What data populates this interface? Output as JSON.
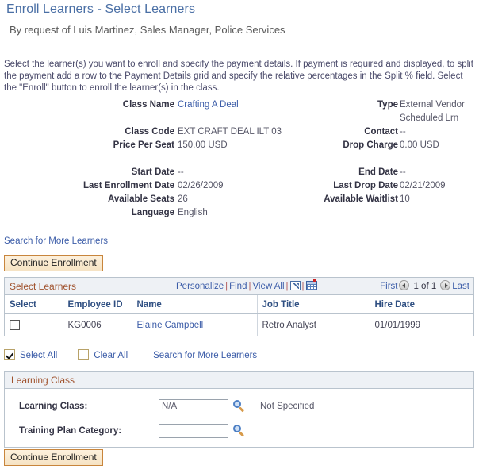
{
  "header": {
    "title": "Enroll Learners - Select Learners",
    "subtitle": "By request of Luis Martinez, Sales Manager, Police Services"
  },
  "instructions": "Select the learner(s) you want to enroll and specify the payment details. If payment is required and displayed, to split the payment add a row to the Payment Details grid and specify the relative percentages in the Split % field. Select the \"Enroll\" button to enroll the learner(s) in the class.",
  "class_details": {
    "left": [
      {
        "label": "Class Name",
        "value": "Crafting A Deal",
        "is_link": true
      },
      {
        "label": "Class Code",
        "value": "EXT CRAFT DEAL ILT 03",
        "is_link": false
      },
      {
        "label": "Price Per Seat",
        "value": "150.00 USD",
        "is_link": false
      },
      {
        "label": "Start Date",
        "value": "--",
        "is_link": false
      },
      {
        "label": "Last Enrollment Date",
        "value": "02/26/2009",
        "is_link": false
      },
      {
        "label": "Available Seats",
        "value": "26",
        "is_link": false
      },
      {
        "label": "Language",
        "value": "English",
        "is_link": false
      }
    ],
    "right": [
      {
        "label": "Type",
        "value": "External Vendor",
        "is_link": false
      },
      {
        "label": "",
        "value": "Scheduled Lrn",
        "is_link": false
      },
      {
        "label": "Contact",
        "value": "--",
        "is_link": false
      },
      {
        "label": "Drop Charge",
        "value": "0.00 USD",
        "is_link": false
      },
      {
        "label": "End Date",
        "value": "--",
        "is_link": false
      },
      {
        "label": "Last Drop Date",
        "value": "02/21/2009",
        "is_link": false
      },
      {
        "label": "Available Waitlist",
        "value": "10",
        "is_link": false
      }
    ]
  },
  "links": {
    "search_more_top": "Search for More Learners",
    "search_more_bottom": "Search for More Learners"
  },
  "buttons": {
    "continue_top": "Continue Enrollment",
    "continue_bottom": "Continue Enrollment"
  },
  "grid": {
    "title": "Select Learners",
    "tools": {
      "personalize": "Personalize",
      "find": "Find",
      "view_all": "View All",
      "expand_icon": "expand-grid-icon",
      "download_icon": "download-to-spreadsheet-icon"
    },
    "nav": {
      "first": "First",
      "counter": "1 of 1",
      "last": "Last",
      "prev_icon": "previous-page-icon",
      "next_icon": "next-page-icon"
    },
    "columns": [
      "Select",
      "Employee ID",
      "Name",
      "Job Title",
      "Hire Date"
    ],
    "rows": [
      {
        "selected": false,
        "employee_id": "KG0006",
        "name": "Elaine Campbell",
        "job_title": "Retro Analyst",
        "hire_date": "01/01/1999"
      }
    ]
  },
  "select_actions": {
    "select_all": "Select All",
    "clear_all": "Clear All"
  },
  "learning_class": {
    "panel_title": "Learning Class",
    "fields": [
      {
        "label": "Learning Class:",
        "value": "N/A",
        "note": "Not Specified"
      },
      {
        "label": "Training Plan Category:",
        "value": "",
        "note": ""
      }
    ]
  },
  "colors": {
    "title_blue": "#4a6fa5",
    "link_blue": "#3b5ca8",
    "section_brown": "#a0522d",
    "column_header_blue": "#2f4f82",
    "button_fill": "#fae9d2",
    "button_border": "#c8853c",
    "grid_header_bg": "#eef1f5",
    "grid_border": "#b9c3cd"
  }
}
